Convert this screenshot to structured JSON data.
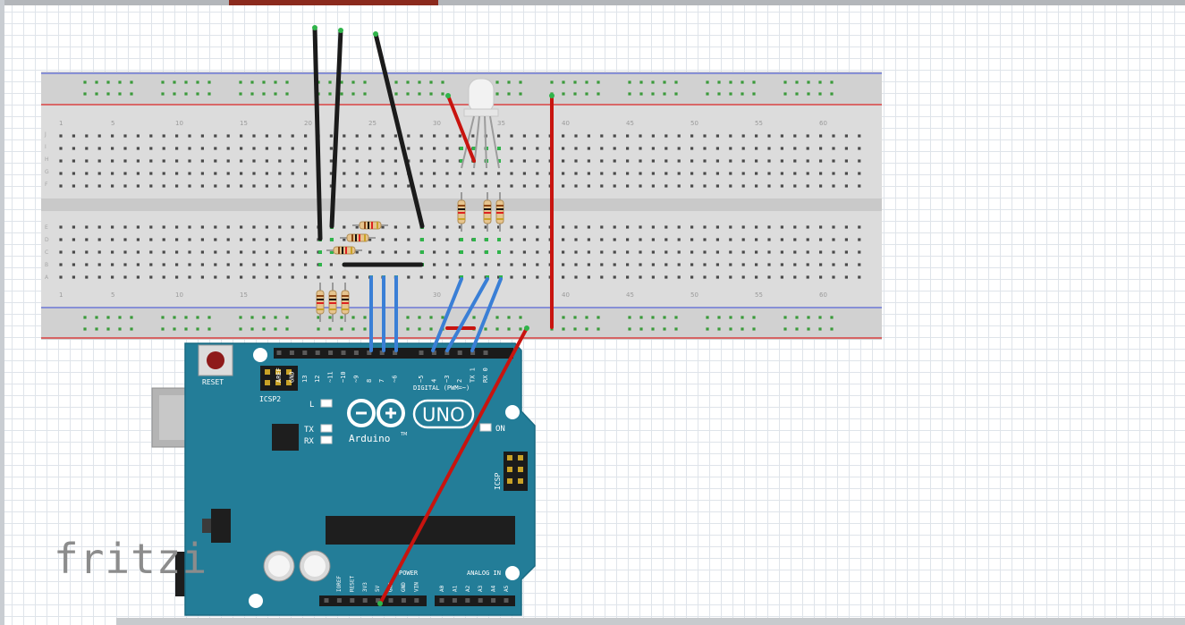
{
  "app": {
    "watermark": "fritzi"
  },
  "arduino": {
    "reset_label": "RESET",
    "icsp2_label": "ICSP2",
    "icsp_label": "ICSP",
    "digital_label": "DIGITAL (PWM=~)",
    "logo_text": "Arduino",
    "logo_tm": "TM",
    "uno_text": "UNO",
    "led_l": "L",
    "led_tx": "TX",
    "led_rx": "RX",
    "led_on": "ON",
    "power_label": "POWER",
    "analog_label": "ANALOG IN",
    "digital_pins": [
      "AREF",
      "GND",
      "13",
      "12",
      "~11",
      "~10",
      "~9",
      "8",
      "7",
      "~6",
      "~5",
      "4",
      "~3",
      "2",
      "TX 1",
      "RX 0"
    ],
    "power_pins": [
      "IOREF",
      "RESET",
      "3V3",
      "5V",
      "GND",
      "GND",
      "VIN"
    ],
    "analog_pins": [
      "A0",
      "A1",
      "A2",
      "A3",
      "A4",
      "A5"
    ]
  },
  "breadboard": {
    "column_numbers": [
      "1",
      "5",
      "10",
      "15",
      "20",
      "25",
      "30",
      "35",
      "40",
      "45",
      "50",
      "55",
      "60"
    ],
    "row_letters_top": [
      "J",
      "I",
      "H",
      "G",
      "F"
    ],
    "row_letters_bottom": [
      "E",
      "D",
      "C",
      "B",
      "A"
    ]
  },
  "colors": {
    "wire_black": "#1b1b1b",
    "wire_red": "#c8140f",
    "wire_blue": "#3a7fd6",
    "board_teal": "#237d98",
    "breadboard": "#dcdcdc"
  }
}
